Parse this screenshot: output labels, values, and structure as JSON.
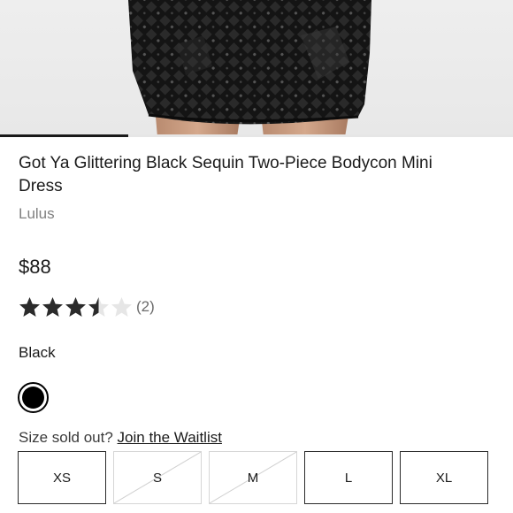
{
  "carousel": {
    "image_alt": "Black sequin mini skirt on model",
    "progress_fraction": 0.25
  },
  "product": {
    "title": "Got Ya Glittering Black Sequin Two-Piece Bodycon Mini Dress",
    "brand": "Lulus",
    "price": "$88",
    "rating": 3.5,
    "rating_max": 5,
    "review_count": "(2)"
  },
  "color": {
    "selected_label": "Black",
    "swatches": [
      {
        "name": "Black",
        "hex": "#000000",
        "selected": true
      }
    ]
  },
  "size": {
    "prompt": "Size sold out?",
    "waitlist_link": "Join the Waitlist",
    "options": [
      {
        "label": "XS",
        "sold_out": false
      },
      {
        "label": "S",
        "sold_out": true
      },
      {
        "label": "M",
        "sold_out": true
      },
      {
        "label": "L",
        "sold_out": false
      },
      {
        "label": "XL",
        "sold_out": false
      }
    ]
  },
  "colors": {
    "star_filled": "#2b2b2b",
    "star_empty": "#e6e6e6",
    "progress": "#1a1a1a"
  }
}
